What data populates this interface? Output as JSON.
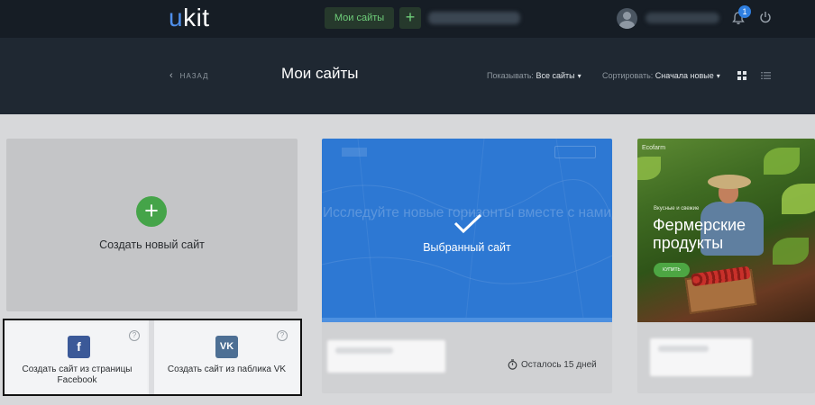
{
  "topbar": {
    "logo_prefix": "u",
    "logo_rest": "kit",
    "my_sites_button": "Мои сайты",
    "add_icon": "plus-icon",
    "notification_count": "1"
  },
  "header": {
    "back_label": "НАЗАД",
    "title": "Мои сайты",
    "show_label": "Показывать:",
    "show_value": "Все сайты",
    "sort_label": "Сортировать:",
    "sort_value": "Сначала новые",
    "view_modes": [
      "grid-view-icon",
      "list-view-icon"
    ]
  },
  "create": {
    "label": "Создать новый сайт",
    "facebook": {
      "icon_letter": "f",
      "label": "Создать сайт из страницы Facebook"
    },
    "vk": {
      "icon_letter": "VK",
      "label": "Создать сайт из паблика VK"
    }
  },
  "selected_site": {
    "ghost_text": "Исследуйте новые горизонты вместе с нами",
    "label": "Выбранный сайт",
    "time_left": "Осталось 15 дней"
  },
  "farm_site": {
    "brand": "Ecofarm",
    "tagline": "Вкусные и свежие",
    "title": "Фермерские продукты",
    "button": "КУПИТЬ"
  },
  "colors": {
    "topbar_bg": "#161d25",
    "header_bg": "#1f2832",
    "accent_green": "#45a449",
    "selected_blue": "#2d78d3"
  }
}
